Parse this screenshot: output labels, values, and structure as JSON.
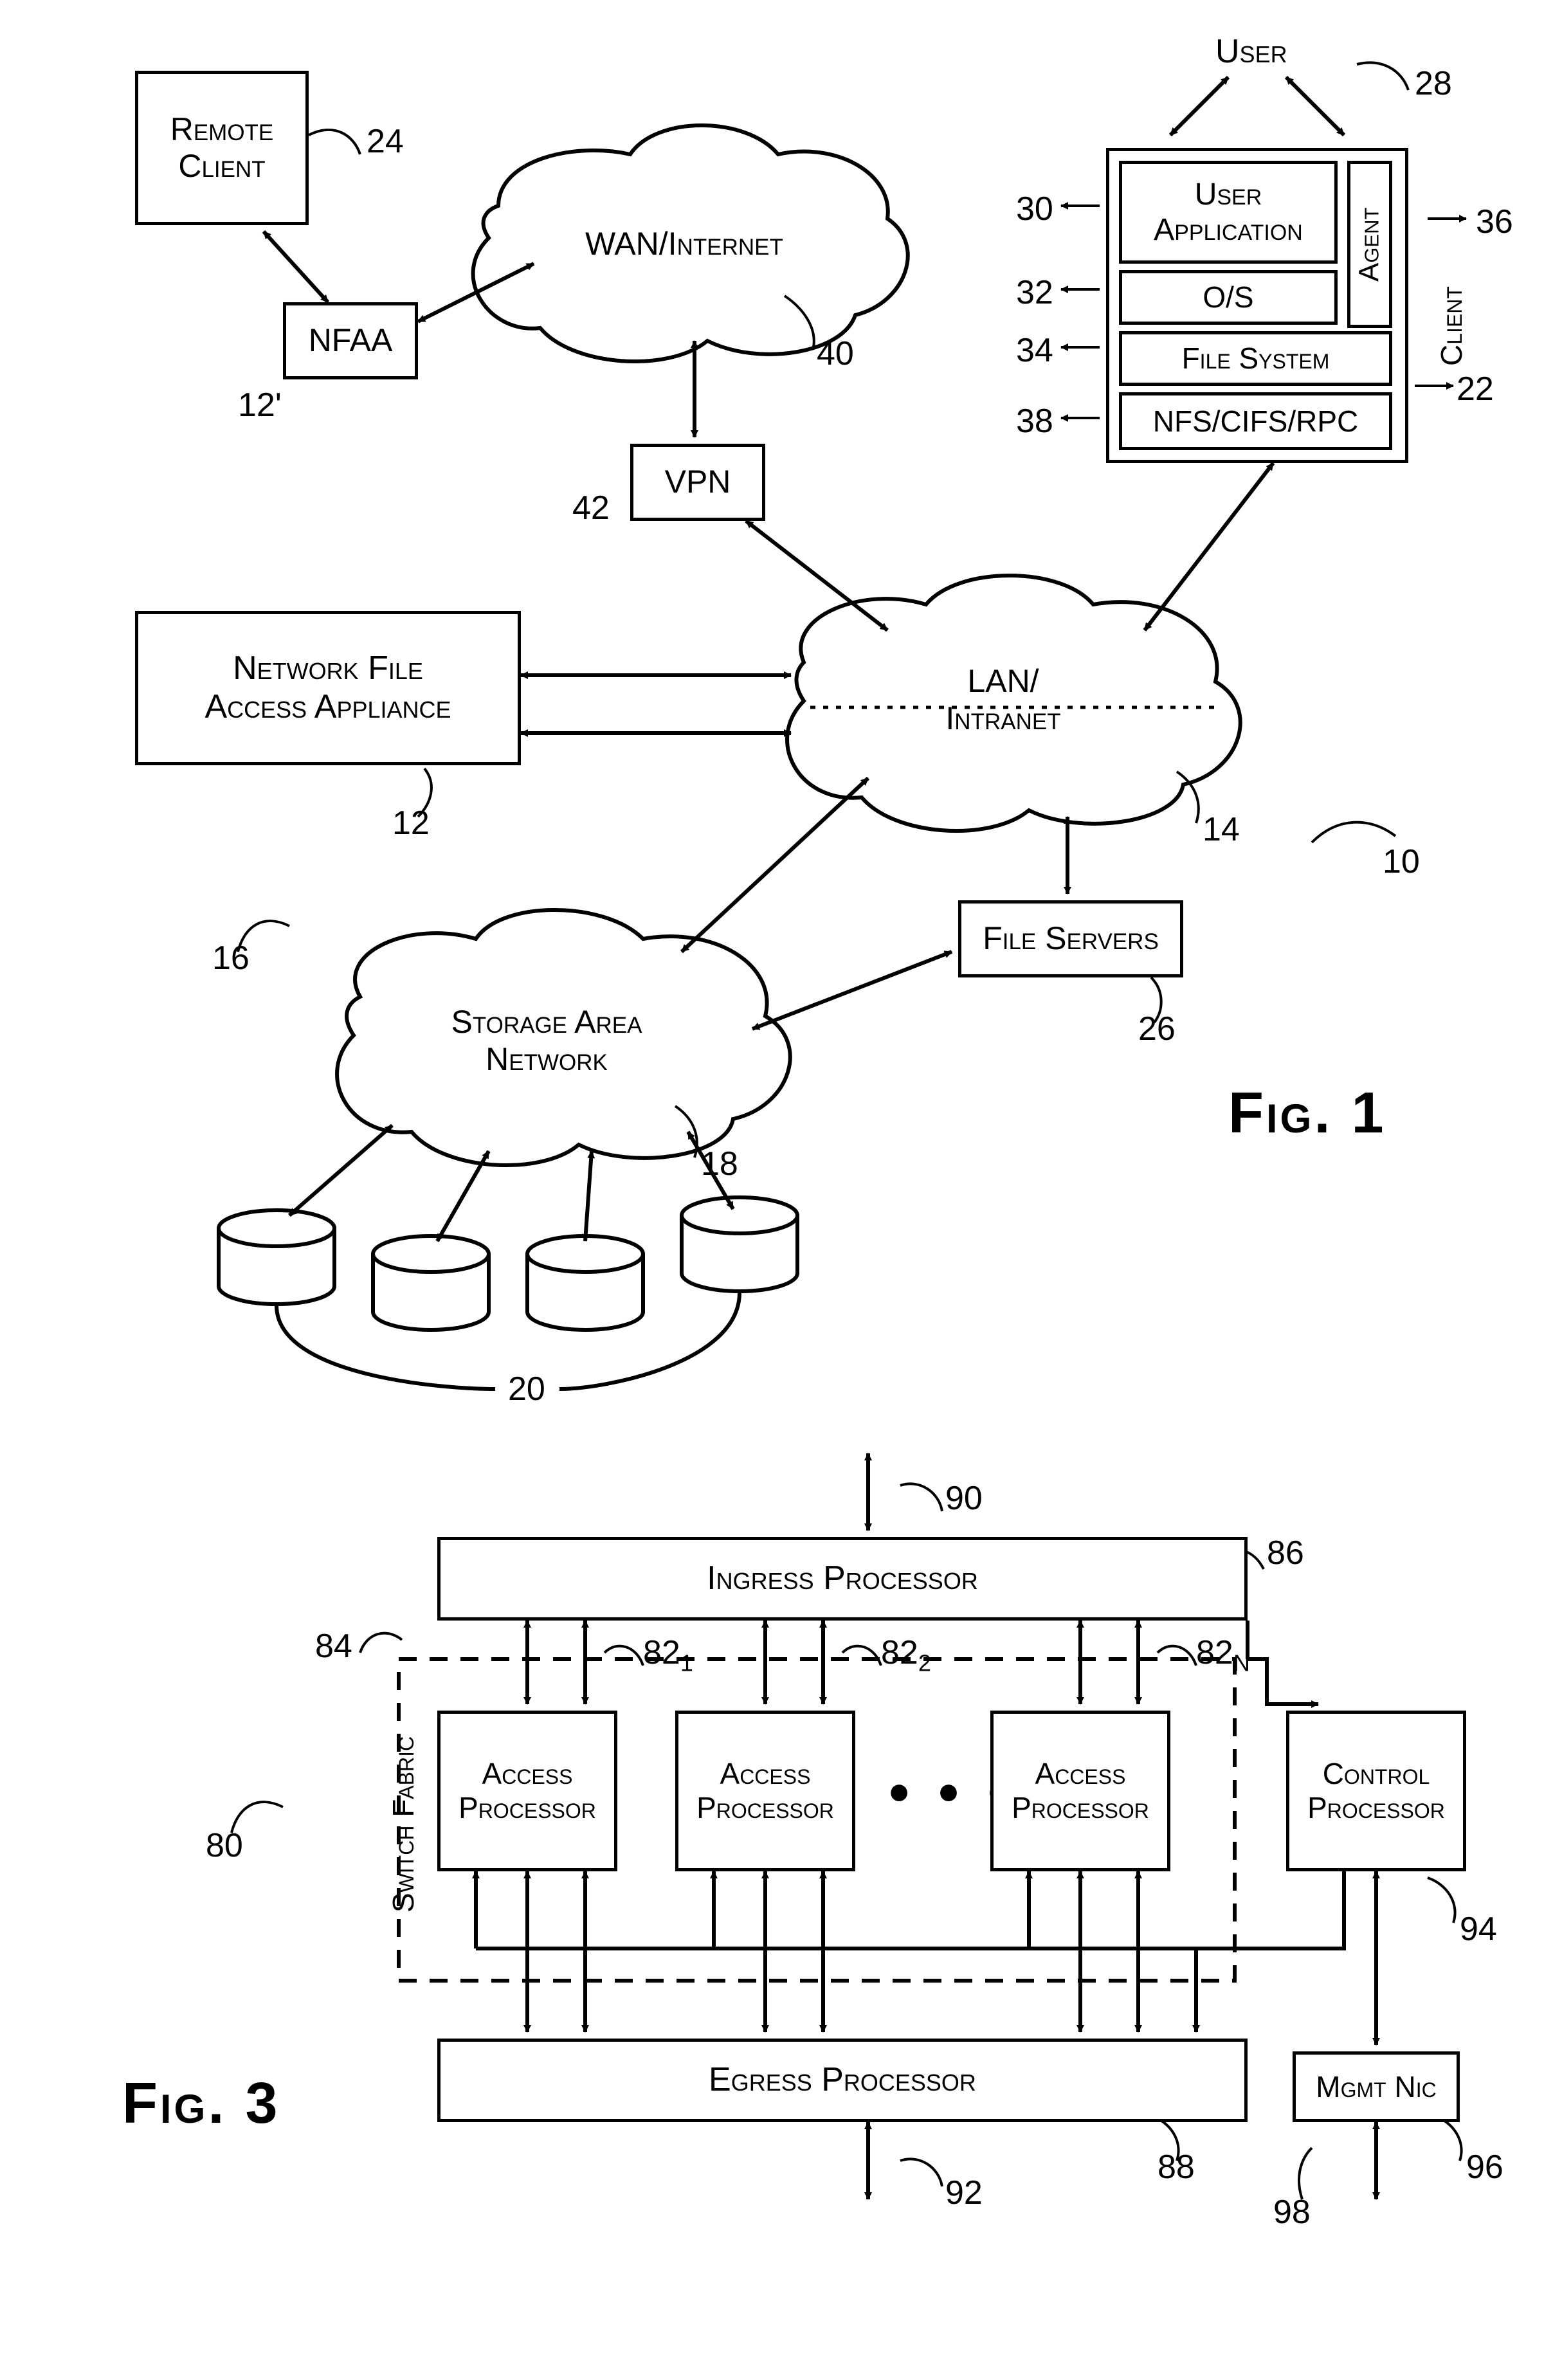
{
  "fig1": {
    "title": "Fig. 1",
    "remote_client": "Remote\nClient",
    "nfaa": "NFAA",
    "wan": "WAN/Internet",
    "vpn": "VPN",
    "nfa_appliance": "Network File\nAccess Appliance",
    "lan": "LAN/\nIntranet",
    "file_servers": "File Servers",
    "san": "Storage Area\nNetwork",
    "user": "User",
    "user_app": "User\nApplication",
    "agent": "Agent",
    "os": "O/S",
    "fs": "File System",
    "nfs": "NFS/CIFS/RPC",
    "client": "Client",
    "refs": {
      "r24": "24",
      "r12p": "12'",
      "r40": "40",
      "r42": "42",
      "r12": "12",
      "r14": "14",
      "r26": "26",
      "r16": "16",
      "r18": "18",
      "r20": "20",
      "r10": "10",
      "r28": "28",
      "r30": "30",
      "r32": "32",
      "r34": "34",
      "r36": "36",
      "r38": "38",
      "r22": "22"
    }
  },
  "fig3": {
    "title": "Fig. 3",
    "ingress": "Ingress Processor",
    "access": "Access\nProcessor",
    "control": "Control\nProcessor",
    "egress": "Egress Processor",
    "mgmt": "Mgmt Nic",
    "switch_fabric": "Switch Fabric",
    "dots": "● ● ●",
    "refs": {
      "r90": "90",
      "r86": "86",
      "r84": "84",
      "r821": "82",
      "r822": "82",
      "r82n": "82",
      "r821s": "1",
      "r822s": "2",
      "r82ns": "N",
      "r80": "80",
      "r94": "94",
      "r92": "92",
      "r88": "88",
      "r98": "98",
      "r96": "96"
    }
  }
}
